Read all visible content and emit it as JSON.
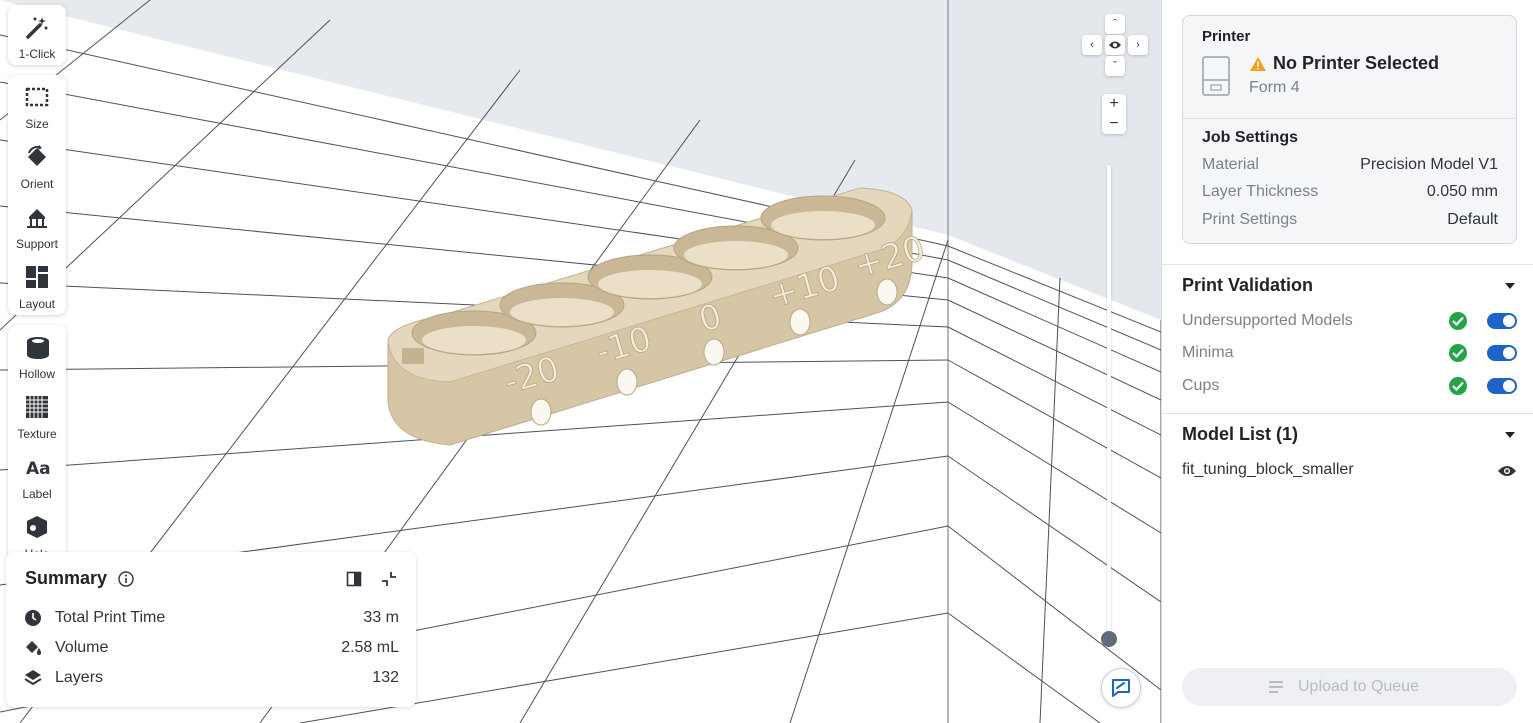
{
  "toolbar": {
    "one_click": "1-Click",
    "size": "Size",
    "orient": "Orient",
    "support": "Support",
    "layout": "Layout",
    "hollow": "Hollow",
    "texture": "Texture",
    "label": "Label",
    "hole": "Hole"
  },
  "model": {
    "engravings": [
      "-20",
      "-10",
      "0",
      "+10",
      "+20"
    ],
    "color": "#d8c8aa"
  },
  "summary": {
    "title": "Summary",
    "rows": [
      {
        "label": "Total Print Time",
        "value": "33 m"
      },
      {
        "label": "Volume",
        "value": "2.58 mL"
      },
      {
        "label": "Layers",
        "value": "132"
      }
    ]
  },
  "printer": {
    "section_title": "Printer",
    "status": "No Printer Selected",
    "model": "Form 4"
  },
  "job_settings": {
    "title": "Job Settings",
    "rows": [
      {
        "label": "Material",
        "value": "Precision Model V1"
      },
      {
        "label": "Layer Thickness",
        "value": "0.050 mm"
      },
      {
        "label": "Print Settings",
        "value": "Default"
      }
    ]
  },
  "print_validation": {
    "title": "Print Validation",
    "items": [
      {
        "label": "Undersupported Models",
        "enabled": true
      },
      {
        "label": "Minima",
        "enabled": true
      },
      {
        "label": "Cups",
        "enabled": true
      }
    ]
  },
  "model_list": {
    "title": "Model List (1)",
    "items": [
      {
        "name": "fit_tuning_block_smaller"
      }
    ]
  },
  "upload_button": "Upload to Queue",
  "colors": {
    "accent": "#1e63c7",
    "success": "#22a447",
    "warning": "#f0a020",
    "viewport_bg": "#f4f5f7"
  }
}
